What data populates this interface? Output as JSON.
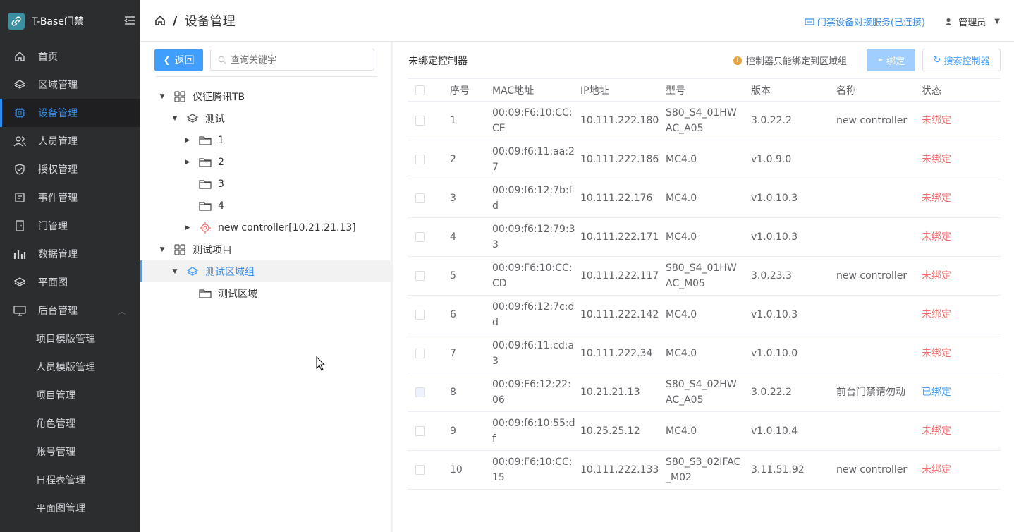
{
  "app": {
    "title": "T-Base门禁"
  },
  "sidebar": {
    "items": [
      {
        "label": "首页",
        "icon": "home-icon"
      },
      {
        "label": "区域管理",
        "icon": "layers-icon"
      },
      {
        "label": "设备管理",
        "icon": "chip-icon",
        "active": true
      },
      {
        "label": "人员管理",
        "icon": "users-icon"
      },
      {
        "label": "授权管理",
        "icon": "shield-icon"
      },
      {
        "label": "事件管理",
        "icon": "document-icon"
      },
      {
        "label": "门管理",
        "icon": "door-icon"
      },
      {
        "label": "数据管理",
        "icon": "bar-chart-icon"
      },
      {
        "label": "平面图",
        "icon": "layers-icon"
      },
      {
        "label": "后台管理",
        "icon": "monitor-icon",
        "expanded": true
      }
    ],
    "sub_items": [
      "项目模版管理",
      "人员模版管理",
      "项目管理",
      "角色管理",
      "账号管理",
      "日程表管理",
      "平面图管理"
    ]
  },
  "header": {
    "breadcrumb_sep": "/",
    "title": "设备管理",
    "connection": "门禁设备对接服务(已连接)",
    "user": "管理员"
  },
  "left": {
    "back_label": "返回",
    "search_placeholder": "查询关键字",
    "tree": [
      {
        "label": "仪征腾讯TB",
        "level": 0,
        "caret": "▼",
        "icon": "grid-icon"
      },
      {
        "label": "测试",
        "level": 1,
        "caret": "▼",
        "icon": "layers-icon"
      },
      {
        "label": "1",
        "level": 2,
        "caret": "▶",
        "icon": "folder-icon"
      },
      {
        "label": "2",
        "level": 2,
        "caret": "▶",
        "icon": "folder-icon"
      },
      {
        "label": "3",
        "level": 2,
        "caret": "",
        "icon": "folder-icon"
      },
      {
        "label": "4",
        "level": 2,
        "caret": "",
        "icon": "folder-icon"
      },
      {
        "label": "new controller[10.21.21.13]",
        "level": 2,
        "caret": "▶",
        "icon": "controller-icon"
      },
      {
        "label": "测试项目",
        "level": 0,
        "caret": "▼",
        "icon": "grid-icon"
      },
      {
        "label": "测试区域组",
        "level": 1,
        "caret": "▼",
        "icon": "layers-icon",
        "selected": true
      },
      {
        "label": "测试区域",
        "level": 2,
        "caret": "",
        "icon": "folder-icon"
      }
    ]
  },
  "right": {
    "title": "未绑定控制器",
    "tip": "控制器只能绑定到区域组",
    "bind_label": "绑定",
    "search_label": "搜索控制器",
    "columns": [
      "序号",
      "MAC地址",
      "IP地址",
      "型号",
      "版本",
      "名称",
      "状态"
    ],
    "rows": [
      {
        "no": "1",
        "mac": [
          "00:09:F6:10:CC:",
          "CE"
        ],
        "ip": "10.111.222.180",
        "model": [
          "S80_S4_01HW",
          "AC_A05"
        ],
        "version": "3.0.22.2",
        "name": "new controller",
        "status": "未绑定",
        "bound": false
      },
      {
        "no": "2",
        "mac": [
          "00:09:f6:11:aa:2",
          "7"
        ],
        "ip": "10.111.222.186",
        "model": [
          "MC4.0"
        ],
        "version": "v1.0.9.0",
        "name": "",
        "status": "未绑定",
        "bound": false
      },
      {
        "no": "3",
        "mac": [
          "00:09:f6:12:7b:f",
          "d"
        ],
        "ip": "10.111.22.176",
        "model": [
          "MC4.0"
        ],
        "version": "v1.0.10.3",
        "name": "",
        "status": "未绑定",
        "bound": false
      },
      {
        "no": "4",
        "mac": [
          "00:09:f6:12:79:3",
          "3"
        ],
        "ip": "10.111.222.171",
        "model": [
          "MC4.0"
        ],
        "version": "v1.0.10.3",
        "name": "",
        "status": "未绑定",
        "bound": false
      },
      {
        "no": "5",
        "mac": [
          "00:09:F6:10:CC:",
          "CD"
        ],
        "ip": "10.111.222.117",
        "model": [
          "S80_S4_01HW",
          "AC_M05"
        ],
        "version": "3.0.23.3",
        "name": "new controller",
        "status": "未绑定",
        "bound": false
      },
      {
        "no": "6",
        "mac": [
          "00:09:f6:12:7c:d",
          "d"
        ],
        "ip": "10.111.222.142",
        "model": [
          "MC4.0"
        ],
        "version": "v1.0.10.3",
        "name": "",
        "status": "未绑定",
        "bound": false
      },
      {
        "no": "7",
        "mac": [
          "00:09:f6:11:cd:a",
          "3"
        ],
        "ip": "10.111.222.34",
        "model": [
          "MC4.0"
        ],
        "version": "v1.0.10.0",
        "name": "",
        "status": "未绑定",
        "bound": false
      },
      {
        "no": "8",
        "mac": [
          "00:09:F6:12:22:",
          "06"
        ],
        "ip": "10.21.21.13",
        "model": [
          "S80_S4_02HW",
          "AC_A05"
        ],
        "version": "3.0.22.2",
        "name": "前台门禁请勿动",
        "status": "已绑定",
        "bound": true
      },
      {
        "no": "9",
        "mac": [
          "00:09:f6:10:55:d",
          "f"
        ],
        "ip": "10.25.25.12",
        "model": [
          "MC4.0"
        ],
        "version": "v1.0.10.4",
        "name": "",
        "status": "未绑定",
        "bound": false
      },
      {
        "no": "10",
        "mac": [
          "00:09:F6:10:CC:",
          "15"
        ],
        "ip": "10.111.222.133",
        "model": [
          "S80_S3_02IFAC",
          "_M02"
        ],
        "version": "3.11.51.92",
        "name": "new controller",
        "status": "未绑定",
        "bound": false
      }
    ]
  },
  "colors": {
    "accent": "#409eff",
    "sidebar_bg": "#2c2d2f",
    "unbound": "#f56c6c"
  }
}
